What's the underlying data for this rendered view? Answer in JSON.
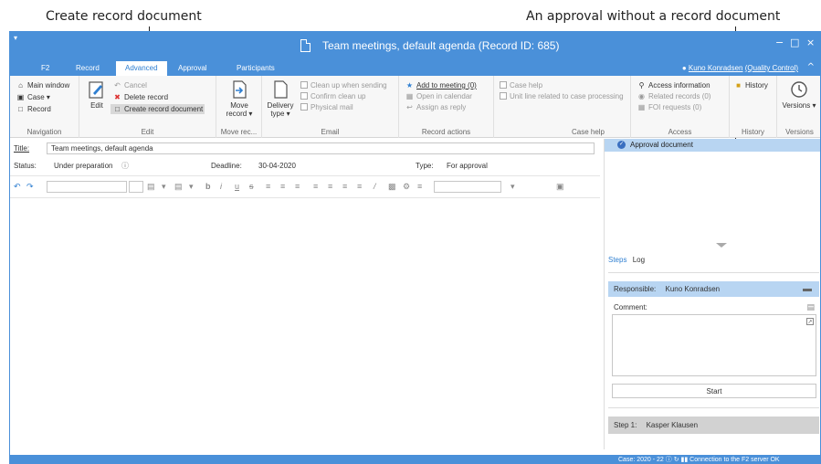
{
  "annotations": {
    "left": "Create record document",
    "right": "An approval without a record document"
  },
  "window": {
    "title": "Team meetings, default agenda (Record ID: 685)",
    "minimize": "−",
    "maximize": "□",
    "close": "×"
  },
  "tabs": [
    "F2",
    "Record",
    "Advanced",
    "Approval",
    "Participants"
  ],
  "user": {
    "name": "Kuno Konradsen",
    "unit": "(Quality Control)"
  },
  "ribbon": {
    "navigation": {
      "label": "Navigation",
      "items": [
        "Main window",
        "Case ▾",
        "Record"
      ]
    },
    "edit": {
      "label": "Edit",
      "edit_button": "Edit",
      "cancel": "Cancel",
      "delete": "Delete record",
      "create_doc": "Create record document"
    },
    "move": {
      "label": "Move rec...",
      "move_button": "Move record ▾"
    },
    "email": {
      "label": "Email",
      "delivery": "Delivery type ▾",
      "clean_up": "Clean up when sending",
      "confirm": "Confirm clean up",
      "physical": "Physical mail"
    },
    "record_actions": {
      "label": "Record actions",
      "add_meeting": "Add to meeting (0)",
      "open_calendar": "Open in calendar",
      "assign_reply": "Assign as reply"
    },
    "case_help": {
      "label": "Case help",
      "case_help": "Case help",
      "unit_line": "Unit line related to case processing"
    },
    "access": {
      "label": "Access",
      "access_info": "Access information",
      "related": "Related records (0)",
      "foi": "FOI requests (0)"
    },
    "history": {
      "label": "History",
      "history": "History"
    },
    "versions": {
      "label": "Versions",
      "versions": "Versions ▾"
    }
  },
  "record": {
    "title_label": "Title:",
    "title_value": "Team meetings, default agenda",
    "status_label": "Status:",
    "status_value": "Under preparation",
    "deadline_label": "Deadline:",
    "deadline_value": "30-04-2020",
    "type_label": "Type:",
    "type_value": "For approval"
  },
  "approval_pane": {
    "approval_document": "Approval document",
    "steps_tab": "Steps",
    "log_tab": "Log",
    "responsible_label": "Responsible:",
    "responsible_value": "Kuno Konradsen",
    "comment_label": "Comment:",
    "start_button": "Start",
    "step1_label": "Step 1:",
    "step1_value": "Kasper Klausen"
  },
  "status_bar": {
    "text": "Case: 2020 - 22 ⓘ ↻ ▮▮   Connection to the F2 server OK"
  },
  "colors": {
    "brand_blue": "#4a90d9",
    "selection_blue": "#b8d5f2"
  }
}
